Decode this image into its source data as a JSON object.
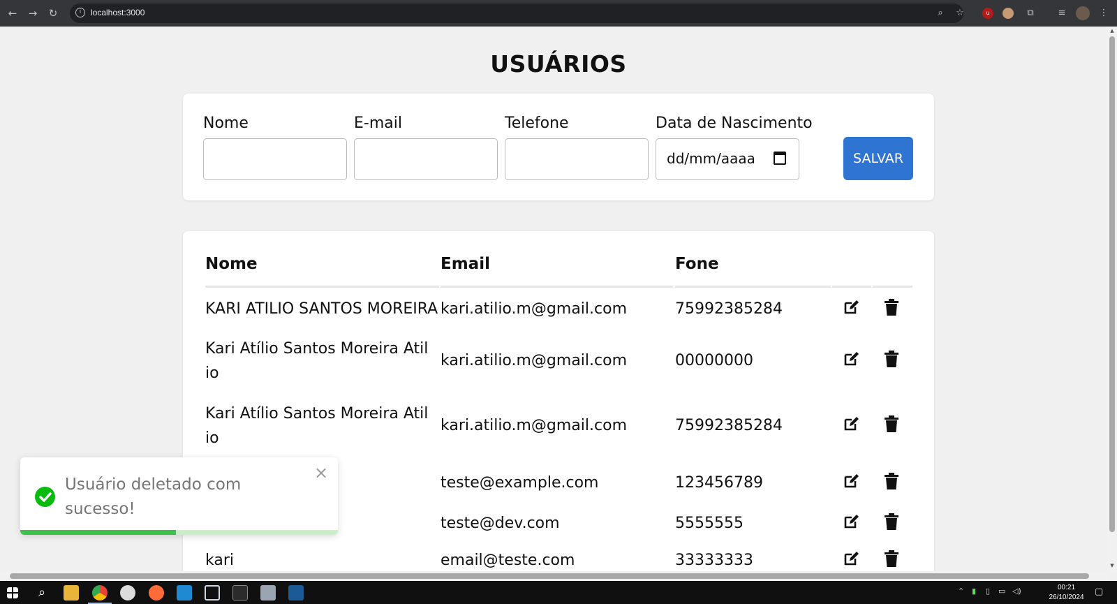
{
  "browser": {
    "url": "localhost:3000",
    "nav_back": "←",
    "nav_forward": "→",
    "reload": "↻"
  },
  "page": {
    "title": "USUÁRIOS"
  },
  "form": {
    "fields": [
      {
        "label": "Nome",
        "value": "",
        "type": "text"
      },
      {
        "label": "E-mail",
        "value": "",
        "type": "text"
      },
      {
        "label": "Telefone",
        "value": "",
        "type": "text"
      },
      {
        "label": "Data de Nascimento",
        "value": "dd/mm/aaaa",
        "type": "date"
      }
    ],
    "save_label": "SALVAR",
    "save_color": "#2f74d0"
  },
  "table": {
    "headers": {
      "name": "Nome",
      "email": "Email",
      "phone": "Fone"
    },
    "rows": [
      {
        "name": "KARI ATILIO SANTOS MOREIRA",
        "email": "kari.atilio.m@gmail.com",
        "phone": "75992385284"
      },
      {
        "name": "Kari Atílio Santos Moreira Atil",
        "name2": "io",
        "email": "kari.atilio.m@gmail.com",
        "phone": "00000000"
      },
      {
        "name": "Kari Atílio Santos Moreira Atil",
        "name2": "io",
        "email": "kari.atilio.m@gmail.com",
        "phone": "75992385284"
      },
      {
        "name": "",
        "email": "teste@example.com",
        "phone": "123456789"
      },
      {
        "name": "",
        "email": "teste@dev.com",
        "phone": "5555555"
      },
      {
        "name": "kari",
        "email": "email@teste.com",
        "phone": "33333333"
      }
    ],
    "actions": {
      "edit_icon": "edit-icon",
      "delete_icon": "trash-icon"
    }
  },
  "toast": {
    "message_line1": "Usuário deletado com",
    "message_line2": "sucesso!",
    "close": "×",
    "progress": 0.49,
    "success_color": "#07bc0c"
  },
  "taskbar": {
    "time": "00:21",
    "date": "26/10/2024"
  }
}
